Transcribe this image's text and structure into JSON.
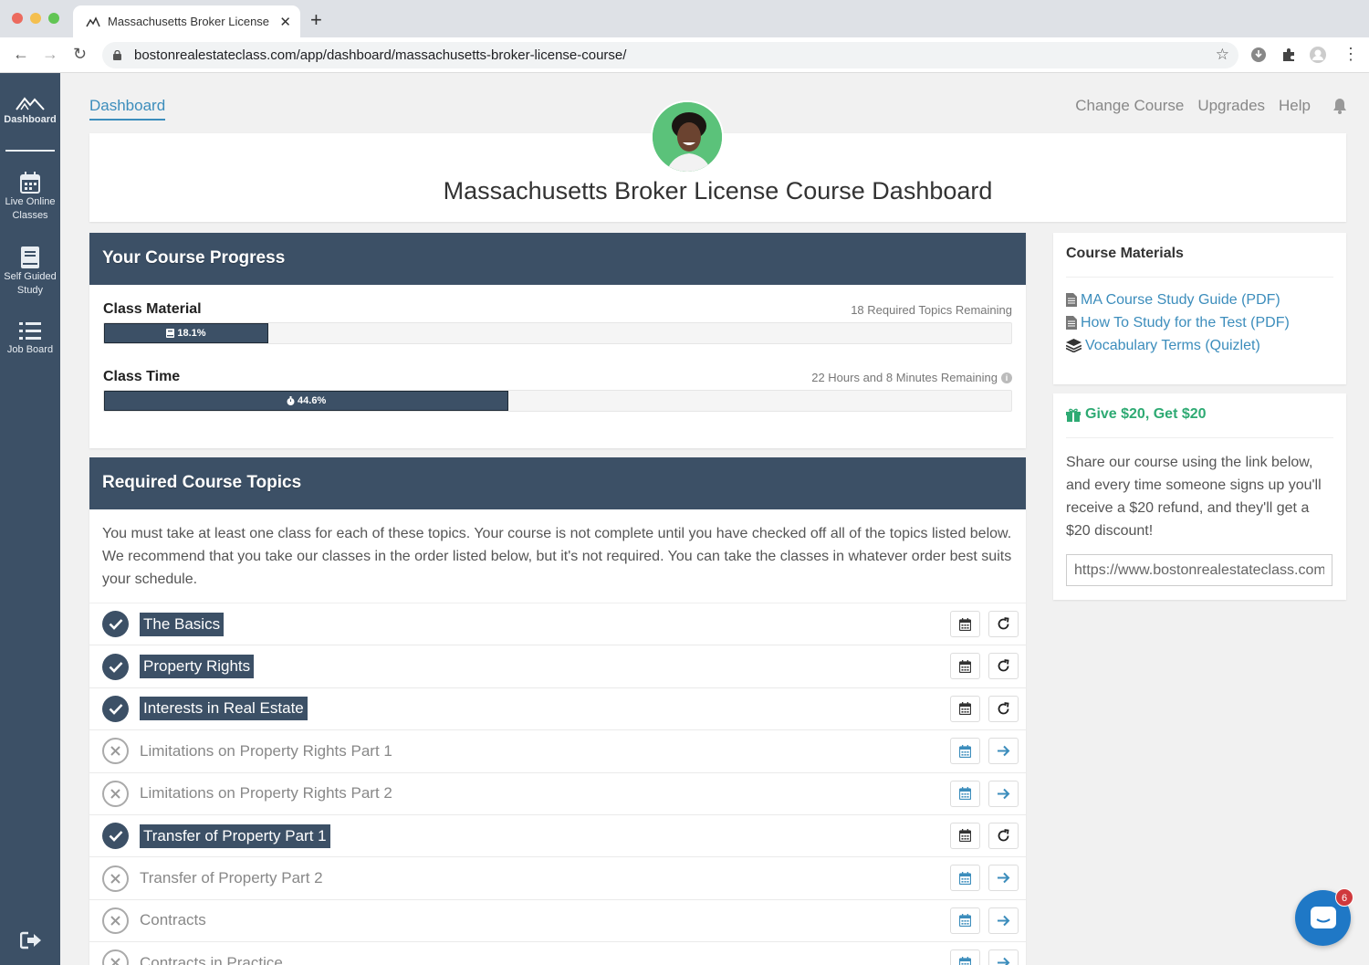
{
  "browser": {
    "tab_title": "Massachusetts Broker License Course",
    "url": "bostonrealestateclass.com/app/dashboard/massachusetts-broker-license-course/"
  },
  "sidebar": {
    "items": [
      {
        "label": "Dashboard",
        "icon": "mountain-logo-icon"
      },
      {
        "label": "Live Online Classes",
        "icon": "calendar-icon"
      },
      {
        "label": "Self Guided Study",
        "icon": "book-icon"
      },
      {
        "label": "Job Board",
        "icon": "list-icon"
      }
    ],
    "logout_icon": "sign-out-icon"
  },
  "topnav": {
    "dashboard": "Dashboard",
    "change_course": "Change Course",
    "upgrades": "Upgrades",
    "help": "Help"
  },
  "header": {
    "title": "Massachusetts Broker License Course Dashboard"
  },
  "progress": {
    "title": "Your Course Progress",
    "class_material": {
      "label": "Class Material",
      "remaining": "18 Required Topics Remaining",
      "percent_label": "18.1%",
      "fraction": 0.181
    },
    "class_time": {
      "label": "Class Time",
      "remaining": "22 Hours and 8 Minutes Remaining",
      "percent_label": "44.6%",
      "fraction": 0.446
    }
  },
  "topics": {
    "title": "Required Course Topics",
    "intro": "You must take at least one class for each of these topics. Your course is not complete until you have checked off all of the topics listed below. We recommend that you take our classes in the order listed below, but it's not required. You can take the classes in whatever order best suits your schedule.",
    "items": [
      {
        "name": "The Basics",
        "done": true
      },
      {
        "name": "Property Rights",
        "done": true
      },
      {
        "name": "Interests in Real Estate",
        "done": true
      },
      {
        "name": "Limitations on Property Rights Part 1",
        "done": false
      },
      {
        "name": "Limitations on Property Rights Part 2",
        "done": false
      },
      {
        "name": "Transfer of Property Part 1",
        "done": true
      },
      {
        "name": "Transfer of Property Part 2",
        "done": false
      },
      {
        "name": "Contracts",
        "done": false
      },
      {
        "name": "Contracts in Practice",
        "done": false
      }
    ]
  },
  "materials": {
    "title": "Course Materials",
    "items": [
      {
        "label": "MA Course Study Guide (PDF)",
        "icon": "file-icon"
      },
      {
        "label": "How To Study for the Test (PDF)",
        "icon": "file-icon"
      },
      {
        "label": "Vocabulary Terms (Quizlet)",
        "icon": "layers-icon"
      }
    ]
  },
  "referral": {
    "title": "Give $20, Get $20",
    "text": "Share our course using the link below, and every time someone signs up you'll receive a $20 refund, and they'll get a $20 discount!",
    "link": "https://www.bostonrealestateclass.com/"
  },
  "chat": {
    "badge_count": "6"
  },
  "colors": {
    "navy": "#3c5066",
    "link": "#3c8dbc",
    "green": "#2eaa73",
    "chat": "#1f78c6"
  }
}
